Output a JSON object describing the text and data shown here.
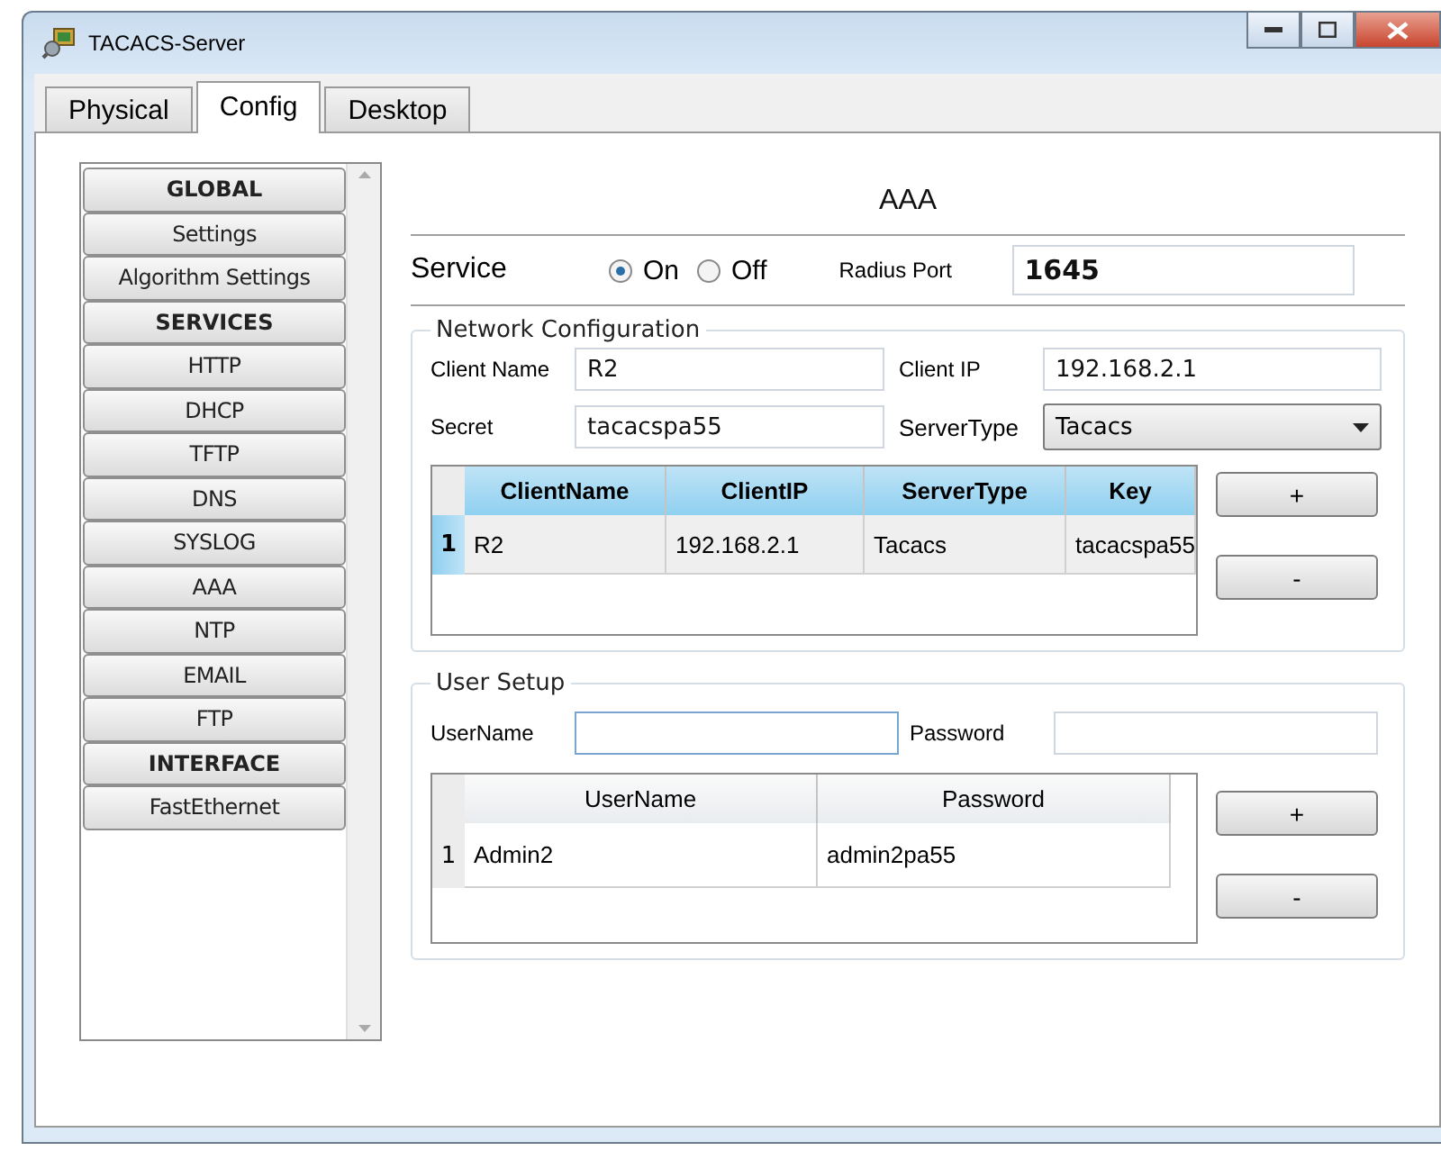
{
  "window": {
    "title": "TACACS-Server"
  },
  "tabs": [
    {
      "label": "Physical",
      "selected": false
    },
    {
      "label": "Config",
      "selected": true
    },
    {
      "label": "Desktop",
      "selected": false
    }
  ],
  "sidebar": {
    "items": [
      {
        "label": "GLOBAL",
        "kind": "header"
      },
      {
        "label": "Settings",
        "kind": "item"
      },
      {
        "label": "Algorithm Settings",
        "kind": "item"
      },
      {
        "label": "SERVICES",
        "kind": "header"
      },
      {
        "label": "HTTP",
        "kind": "item"
      },
      {
        "label": "DHCP",
        "kind": "item"
      },
      {
        "label": "TFTP",
        "kind": "item"
      },
      {
        "label": "DNS",
        "kind": "item"
      },
      {
        "label": "SYSLOG",
        "kind": "item"
      },
      {
        "label": "AAA",
        "kind": "item"
      },
      {
        "label": "NTP",
        "kind": "item"
      },
      {
        "label": "EMAIL",
        "kind": "item"
      },
      {
        "label": "FTP",
        "kind": "item"
      },
      {
        "label": "INTERFACE",
        "kind": "header"
      },
      {
        "label": "FastEthernet",
        "kind": "item"
      }
    ]
  },
  "panel": {
    "title": "AAA",
    "service": {
      "label": "Service",
      "options": [
        {
          "label": "On",
          "selected": true
        },
        {
          "label": "Off",
          "selected": false
        }
      ],
      "port_label": "Radius Port",
      "port_value": "1645"
    },
    "network": {
      "legend": "Network Configuration",
      "client_name_label": "Client Name",
      "client_name": "R2",
      "client_ip_label": "Client IP",
      "client_ip": "192.168.2.1",
      "secret_label": "Secret",
      "secret": "tacacspa55",
      "server_type_label": "ServerType",
      "server_type": "Tacacs",
      "table": {
        "columns": [
          "ClientName",
          "ClientIP",
          "ServerType",
          "Key"
        ],
        "rows": [
          {
            "index": "1",
            "selected": true,
            "cells": [
              "R2",
              "192.168.2.1",
              "Tacacs",
              "tacacspa55"
            ]
          }
        ]
      },
      "buttons": [
        "+",
        "-"
      ]
    },
    "users": {
      "legend": "User Setup",
      "username_label": "UserName",
      "password_label": "Password",
      "table": {
        "columns": [
          "UserName",
          "Password"
        ],
        "rows": [
          {
            "index": "1",
            "selected": false,
            "cells": [
              "Admin2",
              "admin2pa55"
            ]
          }
        ]
      },
      "buttons": [
        "+",
        "-"
      ]
    }
  }
}
